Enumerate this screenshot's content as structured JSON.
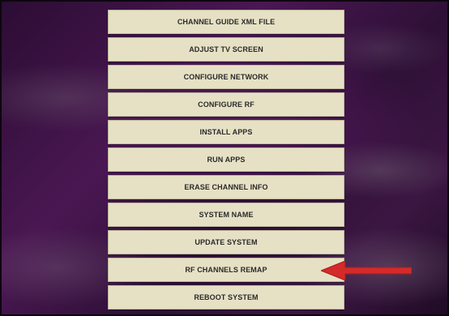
{
  "menu": {
    "items": [
      {
        "label": "CHANNEL GUIDE XML FILE"
      },
      {
        "label": "ADJUST TV SCREEN"
      },
      {
        "label": "CONFIGURE NETWORK"
      },
      {
        "label": "CONFIGURE RF"
      },
      {
        "label": "INSTALL APPS"
      },
      {
        "label": "RUN APPS"
      },
      {
        "label": "ERASE CHANNEL INFO"
      },
      {
        "label": "SYSTEM NAME"
      },
      {
        "label": "UPDATE SYSTEM"
      },
      {
        "label": "RF CHANNELS REMAP"
      },
      {
        "label": "REBOOT SYSTEM"
      }
    ]
  },
  "annotation": {
    "arrow_color": "#d42a2a",
    "points_to": "RF CHANNELS REMAP"
  },
  "colors": {
    "button_bg": "#e6e1c5",
    "button_text": "#2a2a2a",
    "background": "#3a1642"
  }
}
